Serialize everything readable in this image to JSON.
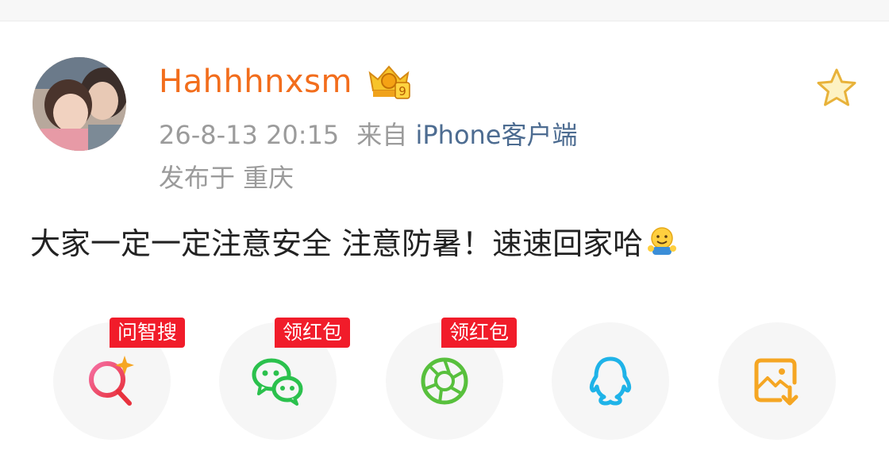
{
  "post": {
    "author": {
      "name": "Hahhhnxsm",
      "vip_level": "9",
      "avatar_icon": "avatar-photo"
    },
    "timestamp": "26-8-13 20:15",
    "source_prefix": "来自",
    "source": "iPhone客户端",
    "location": "发布于 重庆",
    "text": "大家一定一定注意安全 注意防暑！速速回家哈",
    "emoji_icon": "hug-emoji"
  },
  "share_bar": {
    "items": [
      {
        "icon": "ai-search-icon",
        "tag": "问智搜",
        "color": "#ef3b6e"
      },
      {
        "icon": "wechat-icon",
        "tag": "领红包",
        "color": "#2bc14d"
      },
      {
        "icon": "moments-icon",
        "tag": "领红包",
        "color": "#58c03d"
      },
      {
        "icon": "qq-icon",
        "tag": "",
        "color": "#1fb3e8"
      },
      {
        "icon": "save-image-icon",
        "tag": "",
        "color": "#f5a623"
      }
    ]
  },
  "colors": {
    "username": "#f26d1c",
    "meta": "#9b9b9b",
    "source_link": "#4d6c91",
    "tag_bg": "#f11c2a"
  }
}
